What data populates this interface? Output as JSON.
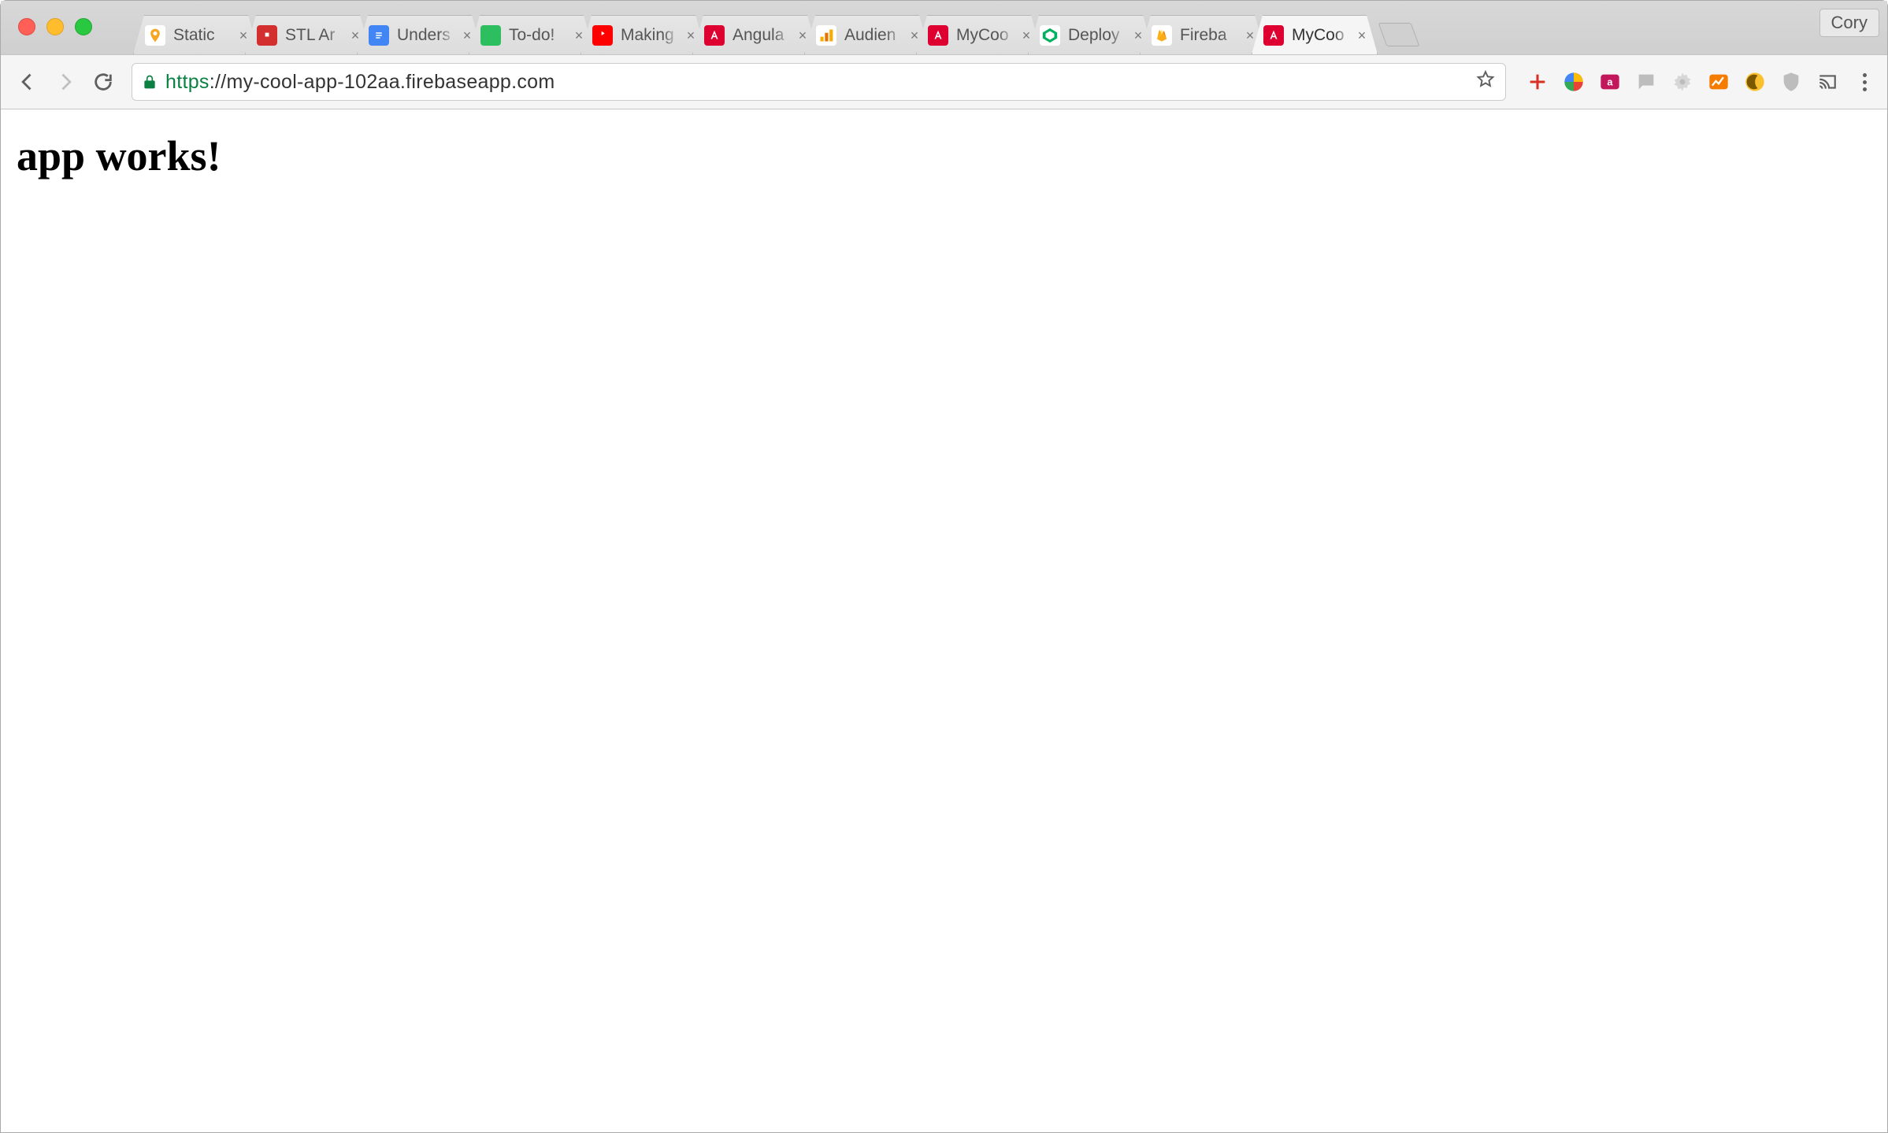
{
  "window": {
    "profile_name": "Cory"
  },
  "tabs": [
    {
      "title": "Static",
      "icon": "map-pin-icon",
      "active": false
    },
    {
      "title": "STL Ar",
      "icon": "stl-icon",
      "active": false
    },
    {
      "title": "Unders",
      "icon": "gdoc-icon",
      "active": false
    },
    {
      "title": "To-do!",
      "icon": "evernote-icon",
      "active": false
    },
    {
      "title": "Making",
      "icon": "youtube-icon",
      "active": false
    },
    {
      "title": "Angula",
      "icon": "angular-icon",
      "active": false
    },
    {
      "title": "Audien",
      "icon": "analytics-icon",
      "active": false
    },
    {
      "title": "MyCoo",
      "icon": "angular-icon",
      "active": false
    },
    {
      "title": "Deploy",
      "icon": "deploy-icon",
      "active": false
    },
    {
      "title": "Fireba",
      "icon": "firebase-icon",
      "active": false
    },
    {
      "title": "MyCoo",
      "icon": "angular-icon",
      "active": true
    }
  ],
  "address_bar": {
    "scheme": "https",
    "url_display_prefix": "https",
    "url_display_rest": "://my-cool-app-102aa.firebaseapp.com"
  },
  "extensions": [
    {
      "name": "plus-extension",
      "color": "#d93025"
    },
    {
      "name": "color-wheel-extension",
      "color": "multi"
    },
    {
      "name": "qi-extension",
      "color": "#c2185b"
    },
    {
      "name": "chat-extension",
      "color": "#bdbdbd"
    },
    {
      "name": "settings-extension",
      "color": "#bdbdbd"
    },
    {
      "name": "chart-extension",
      "color": "#f57c00"
    },
    {
      "name": "moon-extension",
      "color": "#fbc02d"
    },
    {
      "name": "shield-extension",
      "color": "#bdbdbd"
    },
    {
      "name": "cast-extension",
      "color": "#5f5f5f"
    }
  ],
  "page": {
    "heading": "app works!"
  }
}
